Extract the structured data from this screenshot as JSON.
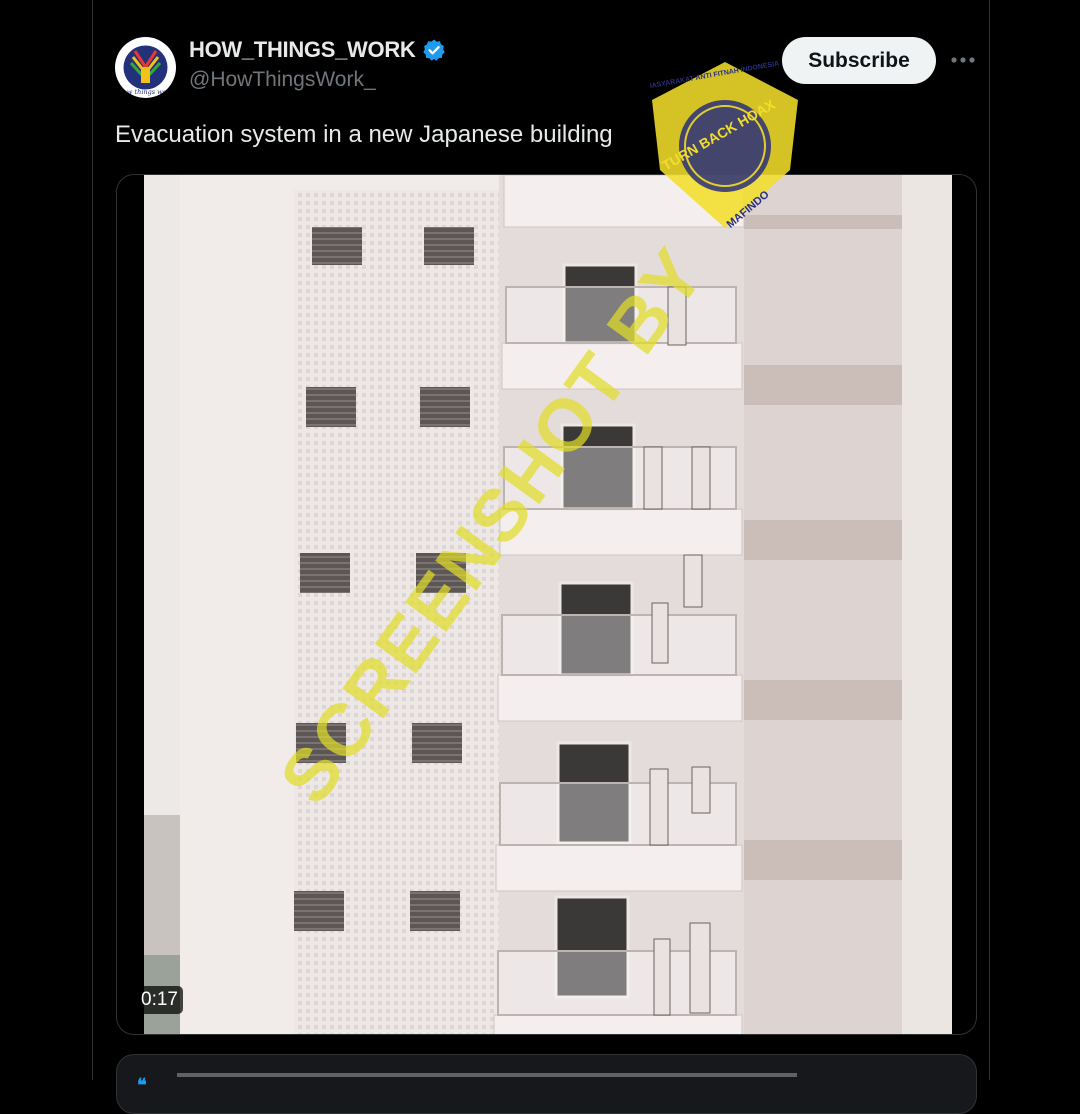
{
  "post": {
    "author": {
      "display_name": "HOW_THINGS_WORK",
      "handle": "@HowThingsWork_",
      "verified": true,
      "avatar_text": "How things work"
    },
    "subscribe_label": "Subscribe",
    "more_icon": "ellipsis-icon",
    "text": "Evacuation system in a new Japanese building",
    "media": {
      "type": "video",
      "duration": "0:17"
    }
  },
  "overlays": {
    "watermark": "SCREENSHOT BY",
    "stamp": {
      "center": "TURN BACK HOAX",
      "ring_top": "MASYARAKAT ANTI FITNAH INDONESIA",
      "ring_bottom": "MAFINDO"
    }
  },
  "colors": {
    "background": "#000000",
    "text_primary": "#e7e9ea",
    "text_secondary": "#71767b",
    "verified": "#1d9bf0",
    "button_bg": "#eff3f4",
    "watermark": "#e1dd28",
    "stamp_fill": "#f2de2a",
    "stamp_center": "#2a2f7a"
  }
}
